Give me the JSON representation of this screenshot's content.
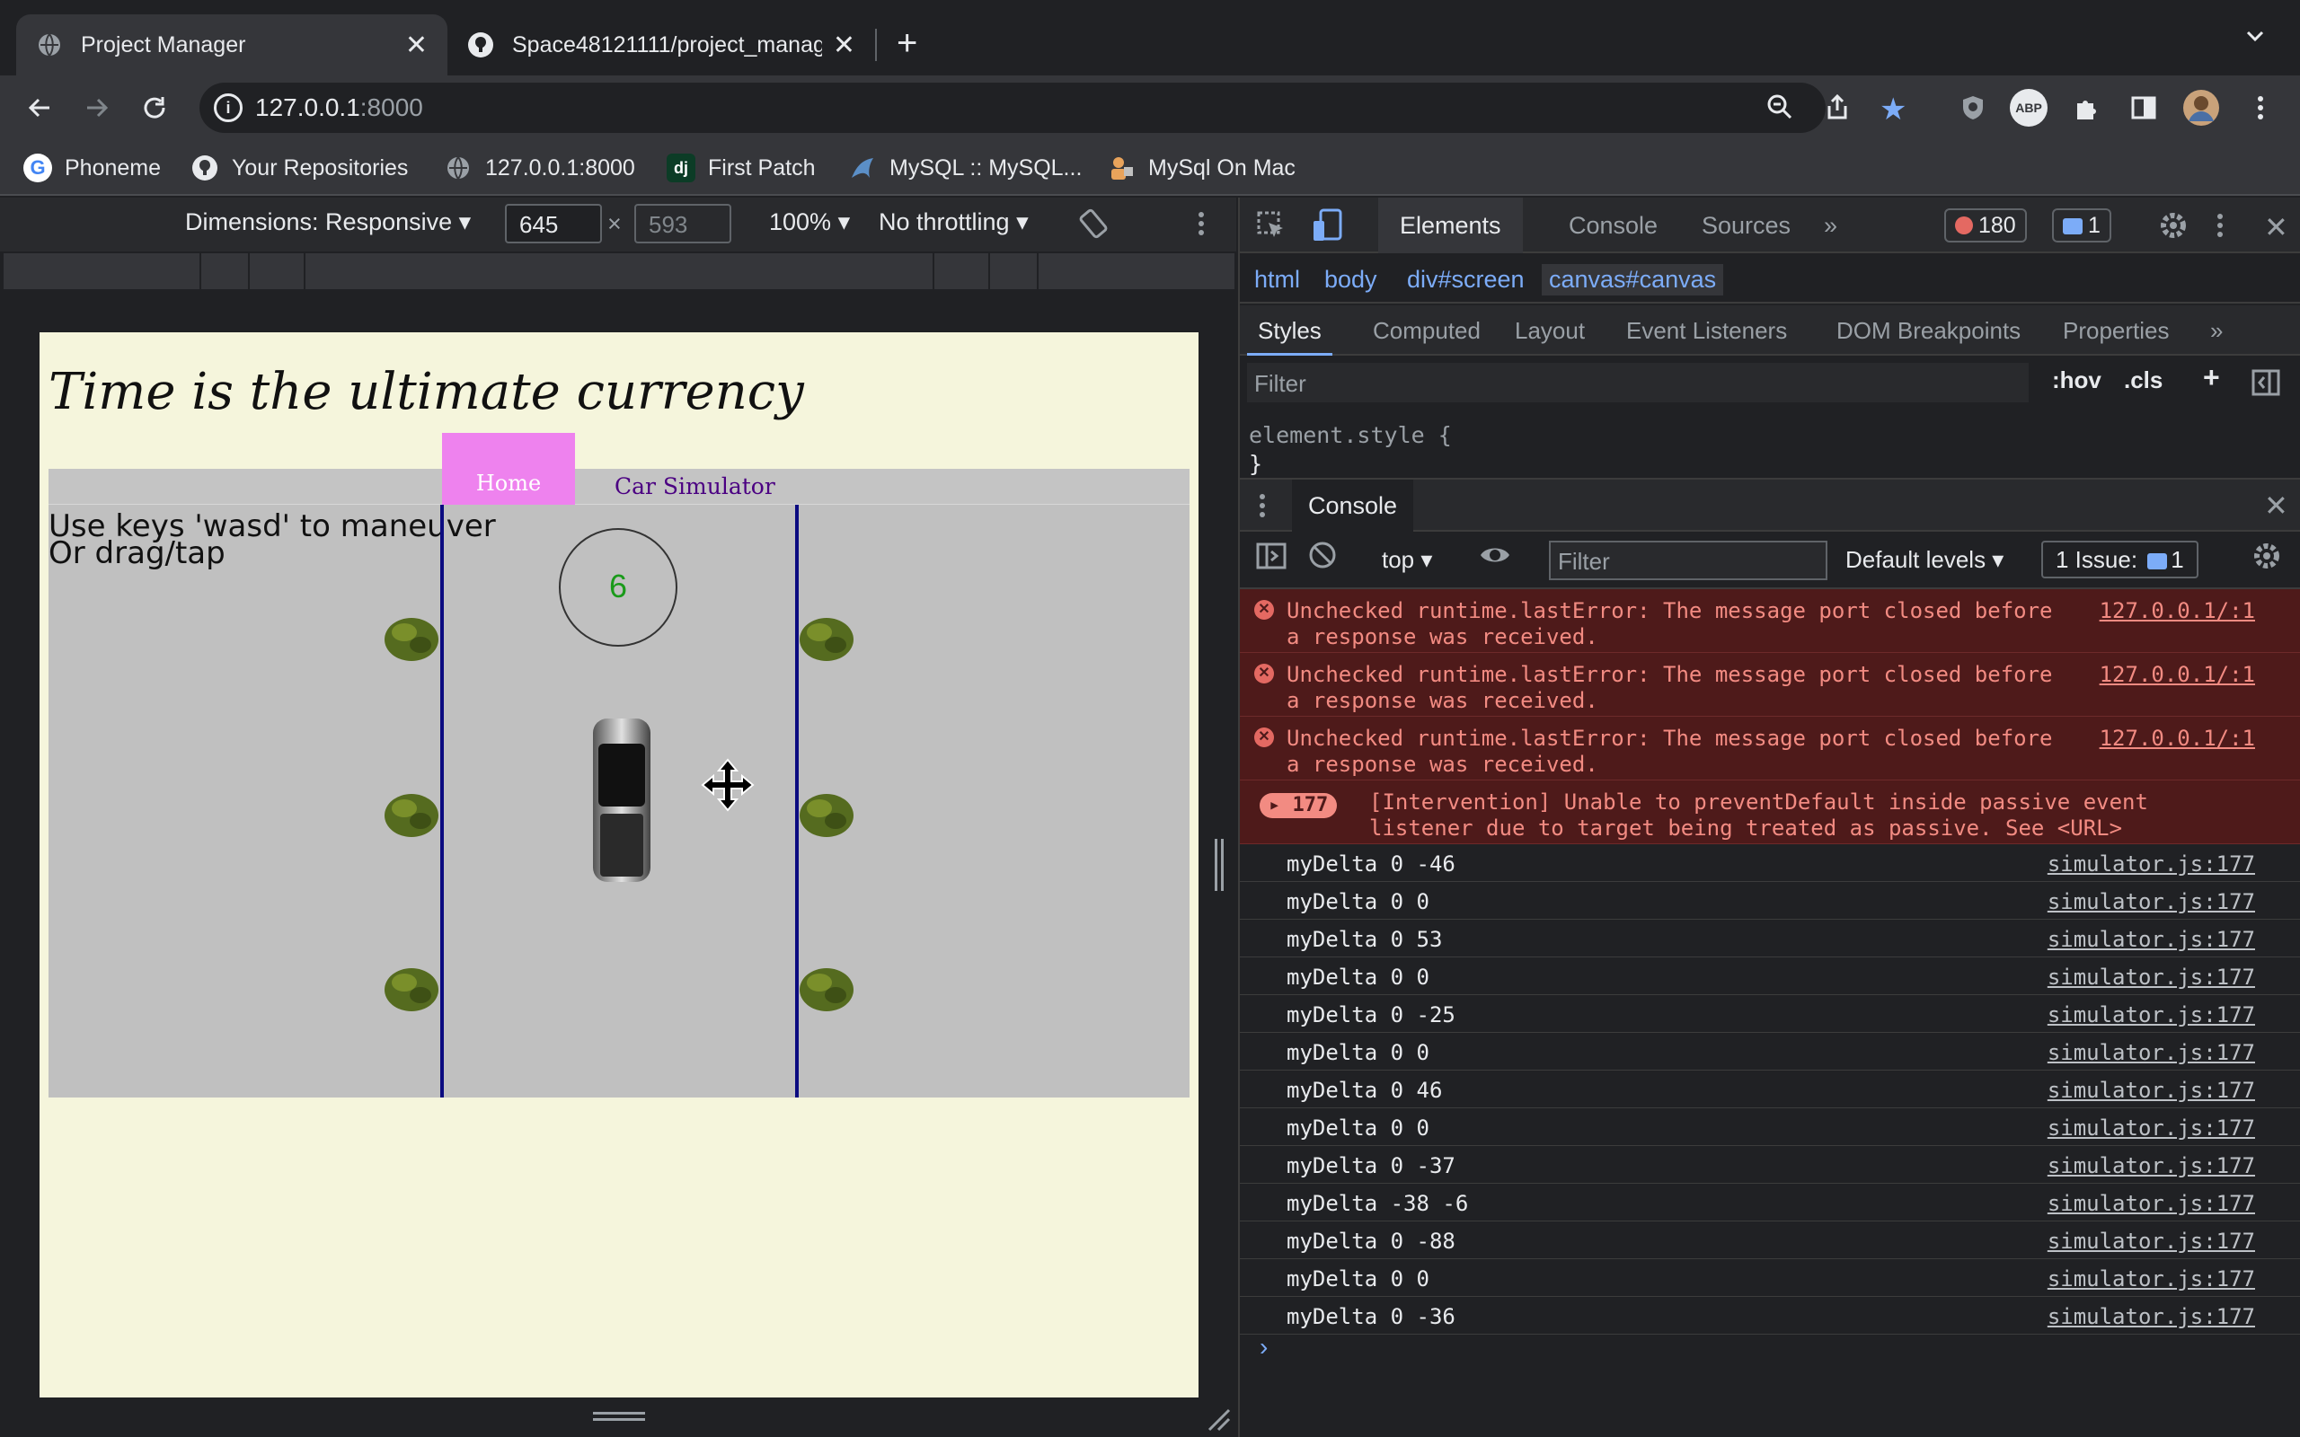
{
  "browser": {
    "tabs": [
      {
        "title": "Project Manager",
        "active": true
      },
      {
        "title": "Space48121111/project_manag",
        "active": false
      }
    ],
    "url_host": "127.0.0.1",
    "url_port": ":8000",
    "bookmarks": [
      {
        "label": "Phoneme",
        "icon": "google-icon"
      },
      {
        "label": "Your Repositories",
        "icon": "github-icon"
      },
      {
        "label": "127.0.0.1:8000",
        "icon": "globe-icon"
      },
      {
        "label": "First Patch",
        "icon": "django-icon"
      },
      {
        "label": "MySQL :: MySQL...",
        "icon": "mysql-icon"
      },
      {
        "label": "MySql On Mac",
        "icon": "mysql-icon"
      }
    ],
    "extension_badge": "ABP"
  },
  "device_toolbar": {
    "dimensions": "Dimensions: Responsive",
    "width": "645",
    "height": "593",
    "times": "×",
    "zoom": "100%",
    "throttling": "No throttling"
  },
  "page": {
    "title": "Time is the ultimate currency",
    "nav": {
      "home": "Home",
      "car_simulator": "Car Simulator"
    },
    "instructions": [
      "Use keys 'wasd' to maneuver",
      "Or drag/tap"
    ],
    "counter": "6"
  },
  "devtools": {
    "tabs": [
      "Elements",
      "Console",
      "Sources"
    ],
    "more": "»",
    "error_count": "180",
    "message_count": "1",
    "breadcrumbs": [
      "html",
      "body",
      "div#screen",
      "canvas#canvas"
    ],
    "styles_tabs": [
      "Styles",
      "Computed",
      "Layout",
      "Event Listeners",
      "DOM Breakpoints",
      "Properties"
    ],
    "styles_filter_placeholder": "Filter",
    "hov": ":hov",
    "cls": ".cls",
    "element_style_open": "element.style {",
    "element_style_close": "}",
    "drawer_tab": "Console",
    "console_toolbar": {
      "context": "top",
      "filter_placeholder": "Filter",
      "levels": "Default levels",
      "issues_label": "1 Issue:",
      "issues_count": "1"
    },
    "errors": [
      {
        "message": "Unchecked runtime.lastError: The message port closed before a response was received.",
        "source": "127.0.0.1/:1"
      },
      {
        "message": "Unchecked runtime.lastError: The message port closed before a response was received.",
        "source": "127.0.0.1/:1"
      },
      {
        "message": "Unchecked runtime.lastError: The message port closed before a response was received.",
        "source": "127.0.0.1/:1"
      }
    ],
    "intervention": {
      "count": "177",
      "message": "[Intervention] Unable to preventDefault inside passive event listener due to target being treated as passive. See <URL>"
    },
    "logs": [
      {
        "message": "myDelta 0 -46",
        "source": "simulator.js:177"
      },
      {
        "message": "myDelta 0 0",
        "source": "simulator.js:177"
      },
      {
        "message": "myDelta 0 53",
        "source": "simulator.js:177"
      },
      {
        "message": "myDelta 0 0",
        "source": "simulator.js:177"
      },
      {
        "message": "myDelta 0 -25",
        "source": "simulator.js:177"
      },
      {
        "message": "myDelta 0 0",
        "source": "simulator.js:177"
      },
      {
        "message": "myDelta 0 46",
        "source": "simulator.js:177"
      },
      {
        "message": "myDelta 0 0",
        "source": "simulator.js:177"
      },
      {
        "message": "myDelta 0 -37",
        "source": "simulator.js:177"
      },
      {
        "message": "myDelta -38 -6",
        "source": "simulator.js:177"
      },
      {
        "message": "myDelta 0 -88",
        "source": "simulator.js:177"
      },
      {
        "message": "myDelta 0 0",
        "source": "simulator.js:177"
      },
      {
        "message": "myDelta 0 -36",
        "source": "simulator.js:177"
      }
    ],
    "prompt": "›"
  },
  "colors": {
    "page_bg": "#f5f5dc",
    "nav_home": "#ee82ee",
    "nav_link": "#4b0082",
    "lane": "#0b0b80",
    "counter": "#1a9a1a",
    "error_bg": "#4e1a1a",
    "error_text": "#f28b82",
    "accent": "#7cacf8"
  }
}
